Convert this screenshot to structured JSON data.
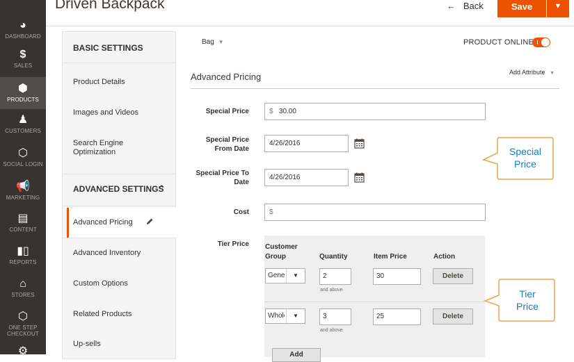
{
  "colors": {
    "accent": "#eb5202",
    "nav_bg": "#373330",
    "callout": "#f0a04b",
    "callout_text": "#1979c3"
  },
  "nav": {
    "items": [
      {
        "label": "DASHBOARD",
        "icon": "dashboard-icon"
      },
      {
        "label": "SALES",
        "icon": "dollar-icon"
      },
      {
        "label": "PRODUCTS",
        "icon": "cube-icon",
        "active": true
      },
      {
        "label": "CUSTOMERS",
        "icon": "person-icon"
      },
      {
        "label": "SOCIAL LOGIN",
        "icon": "hexagon-icon"
      },
      {
        "label": "MARKETING",
        "icon": "megaphone-icon"
      },
      {
        "label": "CONTENT",
        "icon": "content-icon"
      },
      {
        "label": "REPORTS",
        "icon": "bar-chart-icon"
      },
      {
        "label": "STORES",
        "icon": "store-icon"
      },
      {
        "label": "ONE STEP",
        "label2": "CHECKOUT",
        "icon": "hexagon-icon"
      }
    ]
  },
  "header": {
    "title": "Driven Backpack",
    "back_arrow": "←",
    "back_label": "Back",
    "save_label": "Save",
    "split_icon": "▼"
  },
  "panel": {
    "basic_heading": "BASIC SETTINGS",
    "basic_items": [
      "Product Details",
      "Images and Videos",
      "Search Engine",
      "Optimization"
    ],
    "advanced_heading": "ADVANCED SETTINGS",
    "advanced_items": [
      "Advanced Pricing",
      "Advanced Inventory",
      "Custom Options",
      "Related Products",
      "Up-sells"
    ],
    "chevron": "⌃"
  },
  "main": {
    "attribute_set": "Bag",
    "attribute_set_arrow": "▼",
    "product_online_label": "PRODUCT ONLINE",
    "product_online": true,
    "section_title": "Advanced Pricing",
    "add_attribute": "Add Attribute",
    "add_attribute_arrow": "▼",
    "fields": {
      "special_price_label": "Special Price",
      "special_price_currency": "$",
      "special_price_value": "30.00",
      "from_label_1": "Special Price",
      "from_label_2": "From Date",
      "from_value": "4/26/2016",
      "to_label_1": "Special Price To",
      "to_label_2": "Date",
      "to_value": "4/26/2016",
      "cost_label": "Cost",
      "cost_currency": "$",
      "cost_value": ""
    },
    "tier": {
      "label": "Tier Price",
      "headers": {
        "group_1": "Customer",
        "group_2": "Group",
        "quantity": "Quantity",
        "item_price": "Item Price",
        "action": "Action"
      },
      "rows": [
        {
          "group": "General",
          "quantity": "2",
          "note": "and above",
          "price": "30",
          "action": "Delete"
        },
        {
          "group": "Wholesale",
          "quantity": "3",
          "note": "and above",
          "price": "25",
          "action": "Delete"
        }
      ],
      "add_label": "Add"
    }
  },
  "callouts": {
    "special_1": "Special",
    "special_2": "Price",
    "tier_1": "Tier",
    "tier_2": "Price"
  }
}
